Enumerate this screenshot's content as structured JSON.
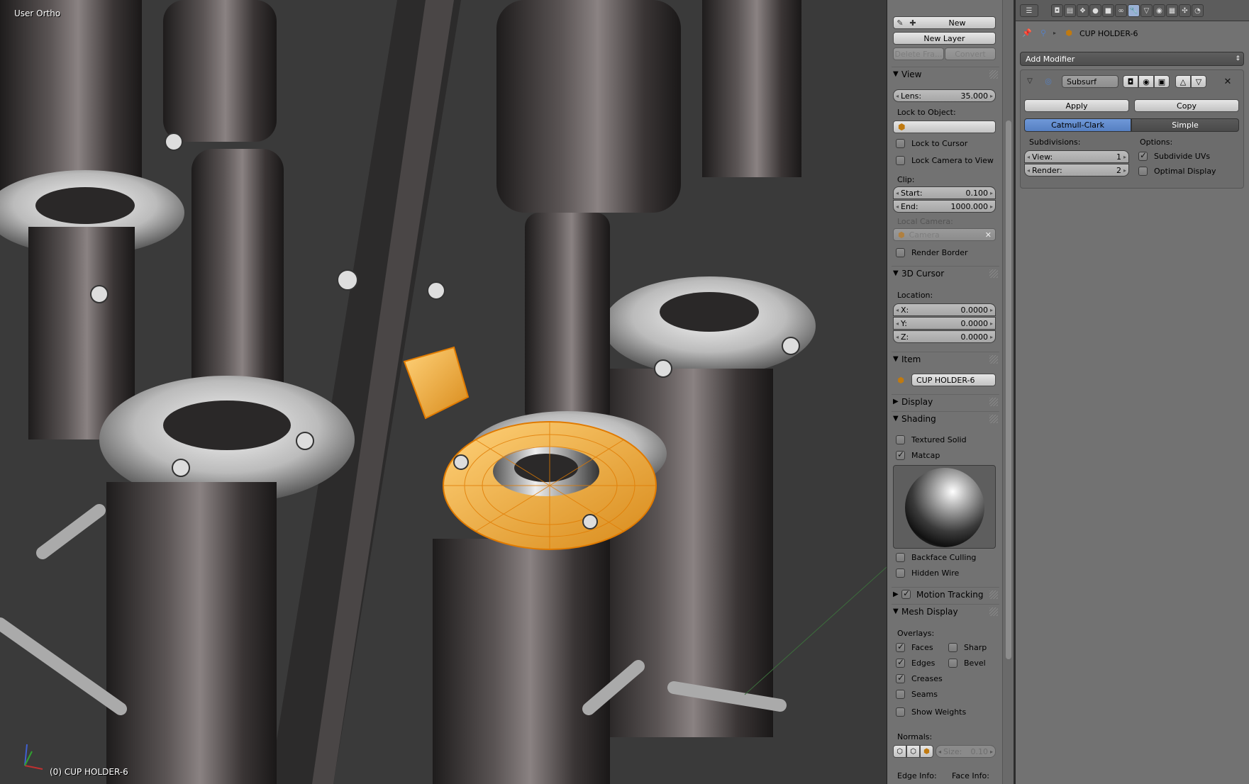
{
  "viewport": {
    "view_name": "User Ortho",
    "object_info": "(0) CUP HOLDER-6"
  },
  "npanel": {
    "grease": {
      "new": "New",
      "new_layer": "New Layer",
      "delete_frame": "Delete Fra...",
      "convert": "Convert"
    },
    "view": {
      "title": "View",
      "lens_label": "Lens:",
      "lens_value": "35.000",
      "lock_to_object": "Lock to Object:",
      "lock_to_cursor": "Lock to Cursor",
      "lock_camera_to_view": "Lock Camera to View",
      "clip": "Clip:",
      "start_label": "Start:",
      "start_value": "0.100",
      "end_label": "End:",
      "end_value": "1000.000",
      "local_camera": "Local Camera:",
      "camera": "Camera",
      "render_border": "Render Border"
    },
    "cursor": {
      "title": "3D Cursor",
      "location": "Location:",
      "x_label": "X:",
      "x_value": "0.0000",
      "y_label": "Y:",
      "y_value": "0.0000",
      "z_label": "Z:",
      "z_value": "0.0000"
    },
    "item": {
      "title": "Item",
      "name": "CUP HOLDER-6"
    },
    "display": {
      "title": "Display"
    },
    "shading": {
      "title": "Shading",
      "textured_solid": "Textured Solid",
      "matcap": "Matcap",
      "backface_culling": "Backface Culling",
      "hidden_wire": "Hidden Wire"
    },
    "motion_tracking": {
      "title": "Motion Tracking"
    },
    "mesh_display": {
      "title": "Mesh Display",
      "overlays": "Overlays:",
      "faces": "Faces",
      "sharp": "Sharp",
      "edges": "Edges",
      "bevel": "Bevel",
      "creases": "Creases",
      "seams": "Seams",
      "show_weights": "Show Weights",
      "normals": "Normals:",
      "size_label": "Size:",
      "size_value": "0.10",
      "edge_info": "Edge Info:",
      "face_info": "Face Info:"
    }
  },
  "properties": {
    "object_name": "CUP HOLDER-6",
    "add_modifier": "Add Modifier",
    "modifier": {
      "name": "Subsurf",
      "apply": "Apply",
      "copy": "Copy",
      "catmull_clark": "Catmull-Clark",
      "simple": "Simple",
      "subdivisions": "Subdivisions:",
      "view_label": "View:",
      "view_value": "1",
      "render_label": "Render:",
      "render_value": "2",
      "options": "Options:",
      "subdivide_uvs": "Subdivide UVs",
      "optimal_display": "Optimal Display"
    }
  },
  "colors": {
    "accent": "#5680c2",
    "selection": "#f0a020",
    "panel": "#727272"
  }
}
